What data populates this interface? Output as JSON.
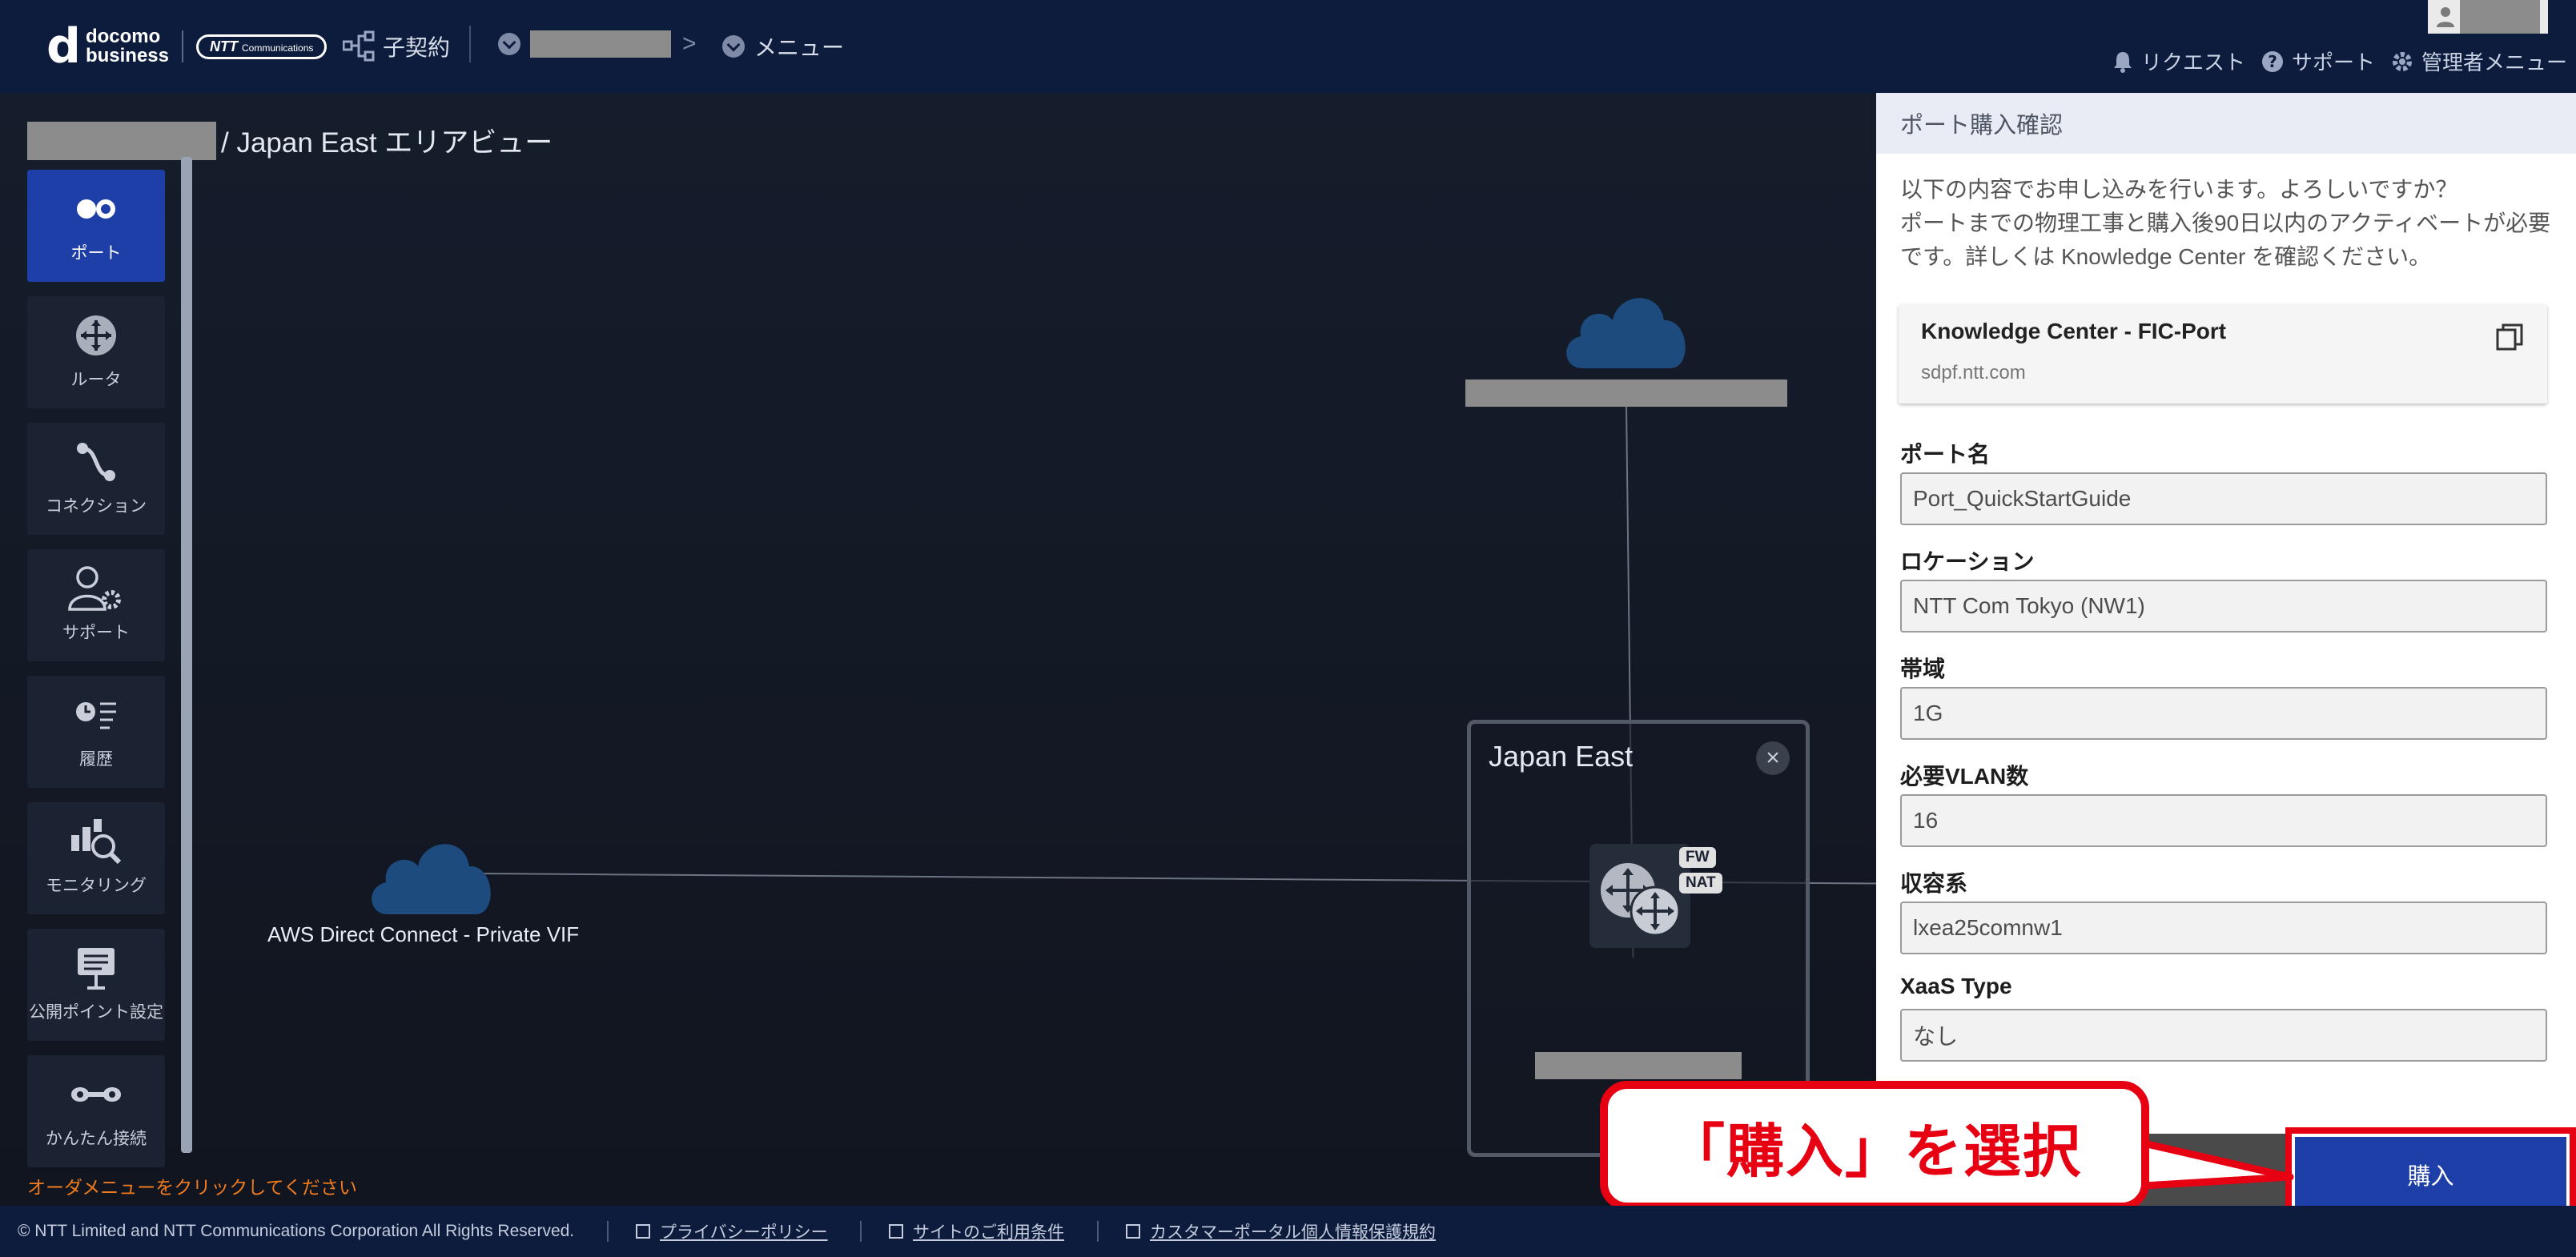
{
  "header": {
    "logo_top": "docomo",
    "logo_bottom": "business",
    "ntt_logo": "NTT",
    "ntt_logo_sub": "Communications",
    "contract_label": "子契約",
    "menu_label": "メニュー",
    "request_label": "リクエスト",
    "support_label": "サポート",
    "admin_label": "管理者メニュー"
  },
  "page": {
    "title": "/ Japan East エリアビュー",
    "order_hint": "オーダメニューをクリックしてください"
  },
  "side_menu": [
    {
      "label": "ポート",
      "icon": "port-icon",
      "active": true
    },
    {
      "label": "ルータ",
      "icon": "router-icon"
    },
    {
      "label": "コネクション",
      "icon": "connection-icon"
    },
    {
      "label": "サポート",
      "icon": "support-icon"
    },
    {
      "label": "履歴",
      "icon": "history-icon"
    },
    {
      "label": "モニタリング",
      "icon": "monitoring-icon"
    },
    {
      "label": "公開ポイント設定",
      "icon": "public-point-icon"
    },
    {
      "label": "かんたん接続",
      "icon": "easy-connect-icon"
    }
  ],
  "network": {
    "cloud_label": "AWS Direct Connect - Private VIF",
    "region_title": "Japan East",
    "tag_fw": "FW",
    "tag_nat": "NAT"
  },
  "panel": {
    "title": "ポート購入確認",
    "message_line1": "以下の内容でお申し込みを行います。よろしいですか？",
    "message_line2": "ポートまでの物理工事と購入後90日以内のアクティベートが必要です。詳しくは Knowledge Center を確認ください。",
    "kc_title": "Knowledge Center - FIC-Port",
    "kc_url": "sdpf.ntt.com",
    "fields": [
      {
        "label": "ポート名",
        "value": "Port_QuickStartGuide"
      },
      {
        "label": "ロケーション",
        "value": "NTT Com Tokyo (NW1)"
      },
      {
        "label": "帯域",
        "value": "1G"
      },
      {
        "label": "必要VLAN数",
        "value": "16"
      },
      {
        "label": "収容系",
        "value": "lxea25comnw1"
      },
      {
        "label": "XaaS Type",
        "value": "なし"
      }
    ],
    "buy_label": "購入"
  },
  "callout": {
    "text": "「購入」を選択"
  },
  "footer": {
    "copyright": "© NTT Limited and NTT Communications Corporation All Rights Reserved.",
    "privacy": "プライバシーポリシー",
    "terms": "サイトのご利用条件",
    "customer_portal": "カスタマーポータル個人情報保護規約"
  },
  "colors": {
    "header_bg": "#0d1c3d",
    "accent_blue": "#1f3fa8",
    "highlight_red": "#e60012",
    "hint_orange": "#f07a1e"
  }
}
